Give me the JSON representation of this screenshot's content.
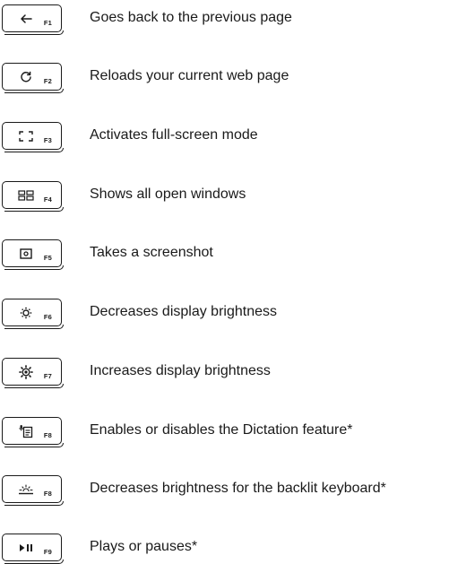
{
  "shortcuts": [
    {
      "key_label": "F1",
      "icon": "back-arrow-icon",
      "description": "Goes back to the previous page"
    },
    {
      "key_label": "F2",
      "icon": "reload-icon",
      "description": "Reloads your current web page"
    },
    {
      "key_label": "F3",
      "icon": "full-screen-icon",
      "description": "Activates full-screen mode"
    },
    {
      "key_label": "F4",
      "icon": "overview-windows-icon",
      "description": "Shows all open windows"
    },
    {
      "key_label": "F5",
      "icon": "screenshot-icon",
      "description": "Takes a screenshot"
    },
    {
      "key_label": "F6",
      "icon": "brightness-down-icon",
      "description": "Decreases display brightness"
    },
    {
      "key_label": "F7",
      "icon": "brightness-up-icon",
      "description": "Increases display brightness"
    },
    {
      "key_label": "F8",
      "icon": "dictation-icon",
      "description": "Enables or disables the Dictation feature*"
    },
    {
      "key_label": "F8",
      "icon": "keyboard-backlight-down-icon",
      "description": "Decreases brightness for the backlit keyboard*"
    },
    {
      "key_label": "F9",
      "icon": "play-pause-icon",
      "description": "Plays or pauses*"
    }
  ]
}
